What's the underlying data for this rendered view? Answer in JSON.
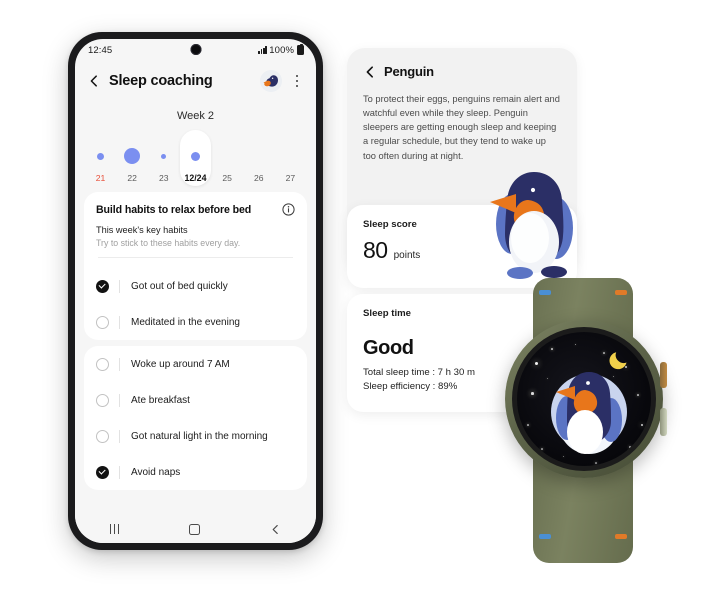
{
  "phone": {
    "status": {
      "time": "12:45",
      "battery_text": "100%",
      "signal_icon": "signal-bars-icon",
      "battery_icon": "battery-icon"
    },
    "app_bar": {
      "back_icon": "back-chevron-icon",
      "title": "Sleep coaching",
      "avatar_icon": "penguin-avatar-icon",
      "menu_icon": "kebab-menu-icon"
    },
    "week": {
      "label": "Week 2"
    },
    "days": [
      {
        "num": "21",
        "dot": 7,
        "selected": false,
        "weekend": true
      },
      {
        "num": "22",
        "dot": 16,
        "selected": false,
        "weekend": false
      },
      {
        "num": "23",
        "dot": 5,
        "selected": false,
        "weekend": false
      },
      {
        "num": "12/24",
        "dot": 9,
        "selected": true,
        "weekend": false
      },
      {
        "num": "25",
        "dot": 0,
        "selected": false,
        "weekend": false
      },
      {
        "num": "26",
        "dot": 0,
        "selected": false,
        "weekend": false
      },
      {
        "num": "27",
        "dot": 0,
        "selected": false,
        "weekend": false
      }
    ],
    "habits_card": {
      "title": "Build habits to relax before bed",
      "info_icon": "info-icon",
      "subtitle": "This week's key habits",
      "note": "Try to stick to these habits every day."
    },
    "habits_group_1": [
      {
        "label": "Got out of bed quickly",
        "checked": true
      },
      {
        "label": "Meditated in the evening",
        "checked": false
      }
    ],
    "habits_group_2": [
      {
        "label": "Woke up around 7 AM",
        "checked": false
      },
      {
        "label": "Ate breakfast",
        "checked": false
      },
      {
        "label": "Got natural light in the morning",
        "checked": false
      },
      {
        "label": "Avoid naps",
        "checked": true
      }
    ],
    "nav": {
      "recents_icon": "recents-icon",
      "home_icon": "home-icon",
      "back_icon": "nav-back-icon"
    }
  },
  "penguin_card": {
    "back_icon": "back-chevron-icon",
    "title": "Penguin",
    "body": "To protect their eggs, penguins remain alert and watchful even while they sleep. Penguin sleepers are getting enough sleep and keeping a regular schedule, but they tend to wake up too often during at night."
  },
  "score_card": {
    "label": "Sleep score",
    "value": "80",
    "unit": "points"
  },
  "time_card": {
    "label": "Sleep time",
    "headline": "Good",
    "total_sleep": "Total sleep time : 7 h 30 m",
    "efficiency": "Sleep efficiency : 89%"
  },
  "watch": {
    "face_icon": "penguin-watch-face-icon",
    "moon_icon": "crescent-moon-icon",
    "button_top_icon": "watch-top-button-icon",
    "button_bottom_icon": "watch-bottom-button-icon"
  },
  "colors": {
    "dot_blue": "#7b8ff0",
    "weekend_red": "#e8503a",
    "penguin_navy": "#2b2f66",
    "penguin_orange": "#e8761b",
    "penguin_blue": "#5b74c4",
    "band_olive": "#6a7152",
    "accent_orange": "#e07a28",
    "accent_blue": "#4a8fd4"
  }
}
